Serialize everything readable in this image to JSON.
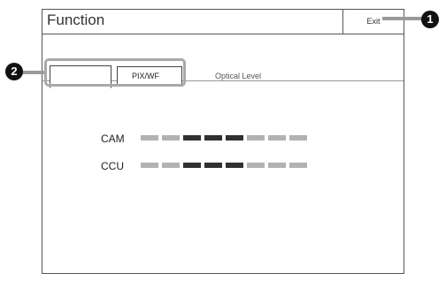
{
  "window": {
    "title": "Function",
    "exit_label": "Exit"
  },
  "tabs": [
    {
      "label": ""
    },
    {
      "label": "PIX/WF"
    },
    {
      "label": "Optical Level"
    }
  ],
  "meters": [
    {
      "label": "CAM",
      "segments": [
        "light",
        "light",
        "dark",
        "dark",
        "dark",
        "light",
        "light",
        "light"
      ]
    },
    {
      "label": "CCU",
      "segments": [
        "light",
        "light",
        "dark",
        "dark",
        "dark",
        "light",
        "light",
        "light"
      ]
    }
  ],
  "callouts": [
    {
      "number": "1"
    },
    {
      "number": "2"
    }
  ]
}
